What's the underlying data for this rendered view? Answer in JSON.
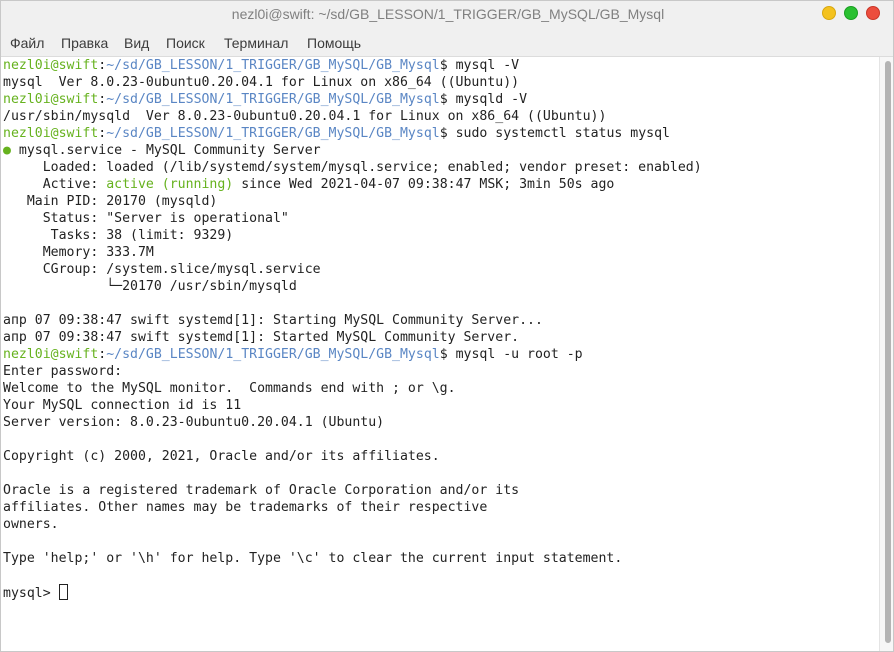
{
  "window": {
    "title": "nezl0i@swift: ~/sd/GB_LESSON/1_TRIGGER/GB_MySQL/GB_Mysql"
  },
  "menu": [
    "Файл",
    "Правка",
    "Вид",
    "Поиск",
    "Терминал",
    "Помощь"
  ],
  "colors": {
    "prompt_user": "#66b21e",
    "prompt_path": "#5a86c4",
    "active_status": "#66b21e",
    "status_dot": "#66b21e"
  },
  "terminal": {
    "user_host": "nezl0i@swift",
    "path": "~/sd/GB_LESSON/1_TRIGGER/GB_MySQL/GB_Mysql",
    "cmd1": "mysql -V",
    "out1": "mysql  Ver 8.0.23-0ubuntu0.20.04.1 for Linux on x86_64 ((Ubuntu))",
    "cmd2": "mysqld -V",
    "out2": "/usr/sbin/mysqld  Ver 8.0.23-0ubuntu0.20.04.1 for Linux on x86_64 ((Ubuntu))",
    "cmd3": "sudo systemctl status mysql",
    "status_dot": "●",
    "service": "mysql.service - MySQL Community Server",
    "loaded": "     Loaded: loaded (/lib/systemd/system/mysql.service; enabled; vendor preset: enabled)",
    "active_label": "     Active: ",
    "active_value": "active (running)",
    "active_rest": " since Wed 2021-04-07 09:38:47 MSK; 3min 50s ago",
    "main_pid": "   Main PID: 20170 (mysqld)",
    "status": "     Status: \"Server is operational\"",
    "tasks": "      Tasks: 38 (limit: 9329)",
    "memory": "     Memory: 333.7M",
    "cgroup": "     CGroup: /system.slice/mysql.service",
    "cgroup_child": "             └─20170 /usr/sbin/mysqld",
    "log1": "апр 07 09:38:47 swift systemd[1]: Starting MySQL Community Server...",
    "log2": "апр 07 09:38:47 swift systemd[1]: Started MySQL Community Server.",
    "cmd4": "mysql -u root -p",
    "enter_password": "Enter password:",
    "welcome": "Welcome to the MySQL monitor.  Commands end with ; or \\g.",
    "connection_id": "Your MySQL connection id is 11",
    "server_version": "Server version: 8.0.23-0ubuntu0.20.04.1 (Ubuntu)",
    "copyright": "Copyright (c) 2000, 2021, Oracle and/or its affiliates.",
    "oracle1": "Oracle is a registered trademark of Oracle Corporation and/or its",
    "oracle2": "affiliates. Other names may be trademarks of their respective",
    "oracle3": "owners.",
    "help": "Type 'help;' or '\\h' for help. Type '\\c' to clear the current input statement.",
    "mysql_prompt": "mysql> "
  }
}
